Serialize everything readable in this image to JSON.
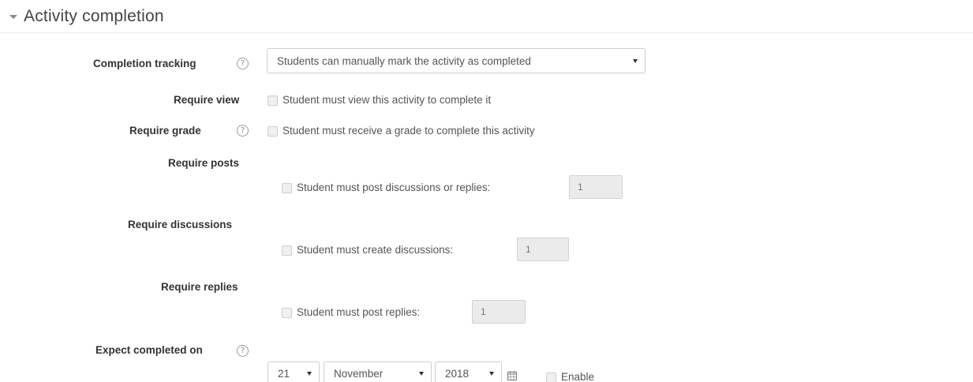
{
  "section": {
    "title": "Activity completion"
  },
  "completion_tracking": {
    "label": "Completion tracking",
    "help": "?",
    "selected": "Students can manually mark the activity as completed"
  },
  "require_view": {
    "label": "Require view",
    "checkbox_label": "Student must view this activity to complete it",
    "checked": false
  },
  "require_grade": {
    "label": "Require grade",
    "help": "?",
    "checkbox_label": "Student must receive a grade to complete this activity",
    "checked": false
  },
  "require_posts": {
    "label": "Require posts",
    "checkbox_label": "Student must post discussions or replies:",
    "value": "1",
    "checked": false
  },
  "require_discussions": {
    "label": "Require discussions",
    "checkbox_label": "Student must create discussions:",
    "value": "1",
    "checked": false
  },
  "require_replies": {
    "label": "Require replies",
    "checkbox_label": "Student must post replies:",
    "value": "1",
    "checked": false
  },
  "expect_completed": {
    "label": "Expect completed on",
    "help": "?",
    "day": "21",
    "month": "November",
    "year": "2018",
    "enable_label": "Enable",
    "enabled": false
  }
}
